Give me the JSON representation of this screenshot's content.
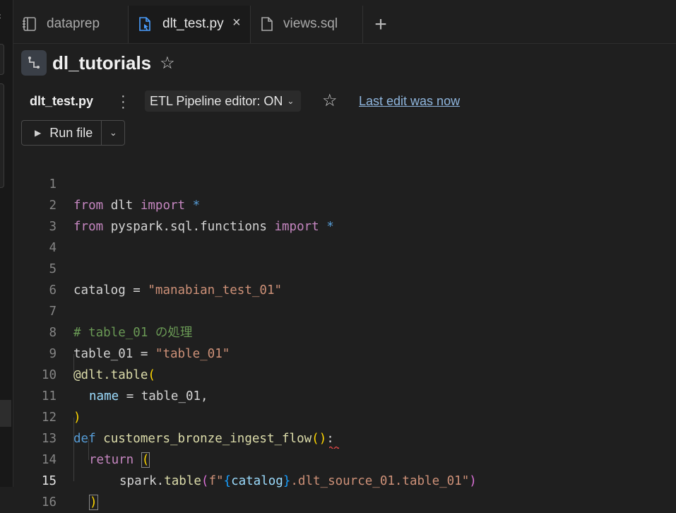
{
  "tabs": [
    {
      "label": "dataprep",
      "icon": "notebook-icon",
      "active": false
    },
    {
      "label": "dlt_test.py",
      "icon": "python-file-icon",
      "active": true,
      "close": "×"
    },
    {
      "label": "views.sql",
      "icon": "file-icon",
      "active": false
    }
  ],
  "tab_add": "+",
  "header": {
    "title": "dl_tutorials",
    "icon": "pipeline-icon"
  },
  "file_bar": {
    "file_name": "dlt_test.py",
    "etl_label": "ETL Pipeline editor: ON",
    "last_edit": "Last edit was now"
  },
  "toolbar": {
    "run_label": "Run file"
  },
  "code": {
    "line_numbers": [
      "1",
      "2",
      "3",
      "4",
      "5",
      "6",
      "7",
      "8",
      "9",
      "10",
      "11",
      "12",
      "13",
      "14",
      "15",
      "16"
    ],
    "current_line": "15",
    "l1": {
      "a": "from",
      "b": " dlt ",
      "c": "import",
      "d": " *"
    },
    "l2": {
      "a": "from",
      "b": " pyspark.sql.functions ",
      "c": "import",
      "d": " *"
    },
    "l5": {
      "a": "catalog",
      "b": " = ",
      "c": "\"manabian_test_01\""
    },
    "l7": {
      "a": "# table_01 の処理"
    },
    "l8": {
      "a": "table_01",
      "b": " = ",
      "c": "\"table_01\""
    },
    "l9": {
      "a": "@dlt.table",
      "b": "("
    },
    "l10": {
      "a": "name",
      "b": " = ",
      "c": "table_01,"
    },
    "l11": {
      "a": ")"
    },
    "l12": {
      "a": "def",
      "b": " ",
      "c": "customers_bronze_ingest_flow",
      "d": "()",
      "e": ":"
    },
    "l13": {
      "a": "return",
      "b": " ",
      "c": "("
    },
    "l14": {
      "a": "spark.",
      "b": "table",
      "c": "(",
      "d": "f\"",
      "e": "{",
      "f": "catalog",
      "g": "}",
      "h": ".dlt_source_01.table_01\"",
      "i": ")"
    },
    "l15": {
      "a": ")"
    }
  },
  "colors": {
    "keyword": "#c586c0",
    "def_keyword": "#569cd6",
    "function": "#dcdcaa",
    "string": "#ce9178",
    "comment": "#6a9955",
    "bracket": "#ffd700",
    "link": "#8fb6de"
  }
}
